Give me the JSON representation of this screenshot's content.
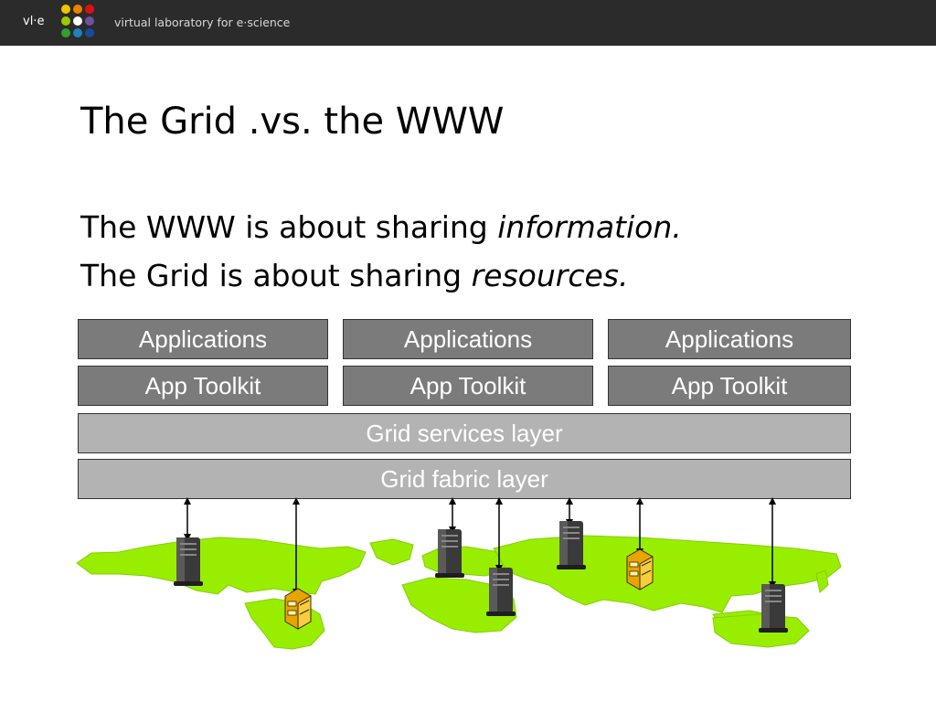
{
  "header": {
    "brand_short": "vl·e",
    "tagline": "virtual laboratory for e·science",
    "logo_icon": "vle-logo-icon",
    "bar_color": "#2b2b2b"
  },
  "slide": {
    "title": "The Grid .vs. the WWW",
    "line1_prefix": "The WWW is about sharing ",
    "line1_emph": "information.",
    "line2_prefix": "The Grid is about sharing ",
    "line2_emph": "resources."
  },
  "diagram": {
    "applications": [
      "Applications",
      "Applications",
      "Applications"
    ],
    "toolkits": [
      "App Toolkit",
      "App Toolkit",
      "App Toolkit"
    ],
    "services_layer": "Grid services layer",
    "fabric_layer": "Grid fabric layer",
    "colors": {
      "dark_box": "#7b7b7b",
      "light_box": "#b3b3b3",
      "continents": "#99ee00"
    },
    "icons": [
      "server-tower-icon",
      "file-cabinet-icon",
      "world-map"
    ]
  }
}
